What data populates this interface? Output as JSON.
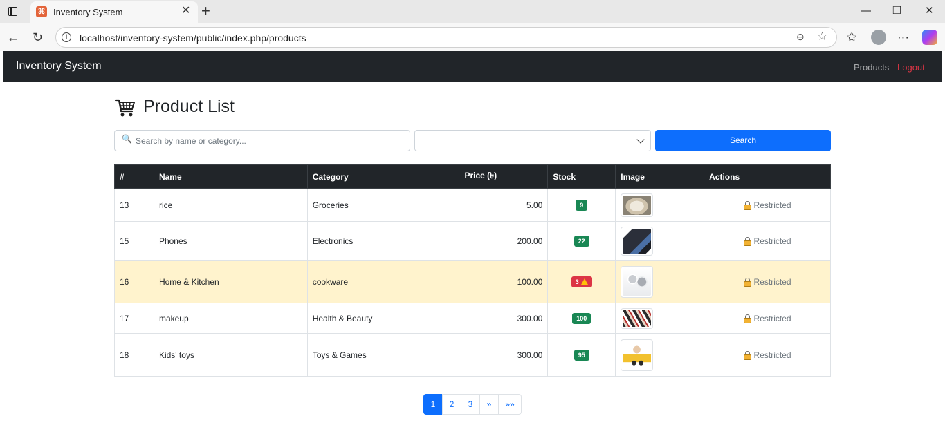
{
  "browser": {
    "tab_title": "Inventory System",
    "tab_favicon": "⌘",
    "url": "localhost/inventory-system/public/index.php/products",
    "icons": [
      "sidebar-toggle-icon",
      "close-icon",
      "new-tab-icon",
      "minimize-icon",
      "restore-icon",
      "window-close-icon",
      "back-icon",
      "reload-icon",
      "site-info-icon",
      "zoom-icon",
      "favorite-icon",
      "favorites-list-icon",
      "profile-icon",
      "more-icon",
      "copilot-icon"
    ]
  },
  "navbar": {
    "brand": "Inventory System",
    "links": [
      {
        "label": "Products",
        "color": "#9a9c9e"
      },
      {
        "label": "Logout",
        "color": "#dc3545"
      }
    ]
  },
  "page": {
    "title": "Product List",
    "title_icon": "shopping-cart-icon"
  },
  "filters": {
    "search_placeholder": "Search by name or category...",
    "search_value": "",
    "category_selected": "",
    "search_button": "Search"
  },
  "table": {
    "columns": [
      "#",
      "Name",
      "Category",
      "Price (৳)",
      "Stock",
      "Image",
      "Actions"
    ],
    "rows": [
      {
        "id": "13",
        "name": "rice",
        "category": "Groceries",
        "price": "5.00",
        "stock": "9",
        "low_stock": false,
        "image": "rice",
        "action": "Restricted"
      },
      {
        "id": "15",
        "name": "Phones",
        "category": "Electronics",
        "price": "200.00",
        "stock": "22",
        "low_stock": false,
        "image": "phone",
        "action": "Restricted"
      },
      {
        "id": "16",
        "name": "Home & Kitchen",
        "category": "cookware",
        "price": "100.00",
        "stock": "3",
        "low_stock": true,
        "image": "cookware",
        "action": "Restricted"
      },
      {
        "id": "17",
        "name": "makeup",
        "category": "Health & Beauty",
        "price": "300.00",
        "stock": "100",
        "low_stock": false,
        "image": "makeup",
        "action": "Restricted"
      },
      {
        "id": "18",
        "name": "Kids' toys",
        "category": "Toys & Games",
        "price": "300.00",
        "stock": "95",
        "low_stock": false,
        "image": "toys",
        "action": "Restricted"
      }
    ]
  },
  "pagination": {
    "pages": [
      "1",
      "2",
      "3"
    ],
    "next": "»",
    "last": "»»",
    "current": "1"
  },
  "colors": {
    "navbar_bg": "#212529",
    "primary": "#0d6efd",
    "success_badge": "#198754",
    "danger_badge": "#dc3545",
    "warning_row": "#fff3cd"
  }
}
